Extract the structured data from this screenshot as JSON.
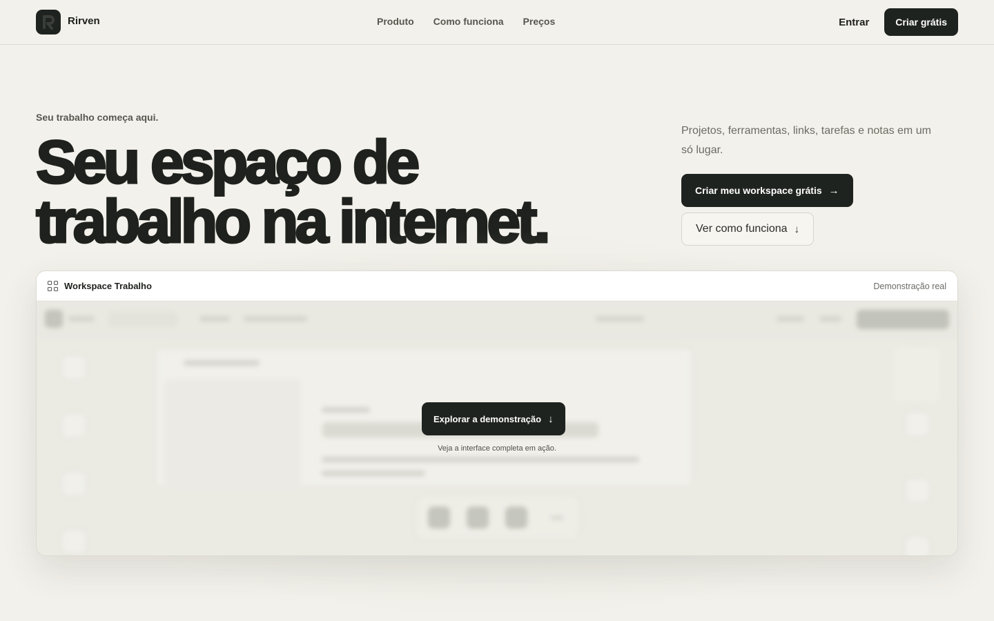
{
  "nav": {
    "brand": "Rirven",
    "links": [
      "Produto",
      "Como funciona",
      "Preços"
    ],
    "login": "Entrar",
    "signup": "Criar grátis"
  },
  "hero": {
    "eyebrow": "Seu trabalho começa aqui.",
    "title_line1": "Seu espaço de",
    "title_line2": "trabalho na internet.",
    "subtitle": "Projetos, ferramentas, links, tarefas e notas em um só lugar.",
    "cta_primary": "Criar meu workspace grátis",
    "cta_secondary": "Ver como funciona"
  },
  "demo": {
    "title": "Workspace Trabalho",
    "tag": "Demonstração real",
    "explore_button": "Explorar a demonstração",
    "caption": "Veja a interface completa em ação."
  },
  "colors": {
    "background": "#f3f1eb",
    "dark": "#1f2320",
    "muted": "#6a6c64"
  }
}
